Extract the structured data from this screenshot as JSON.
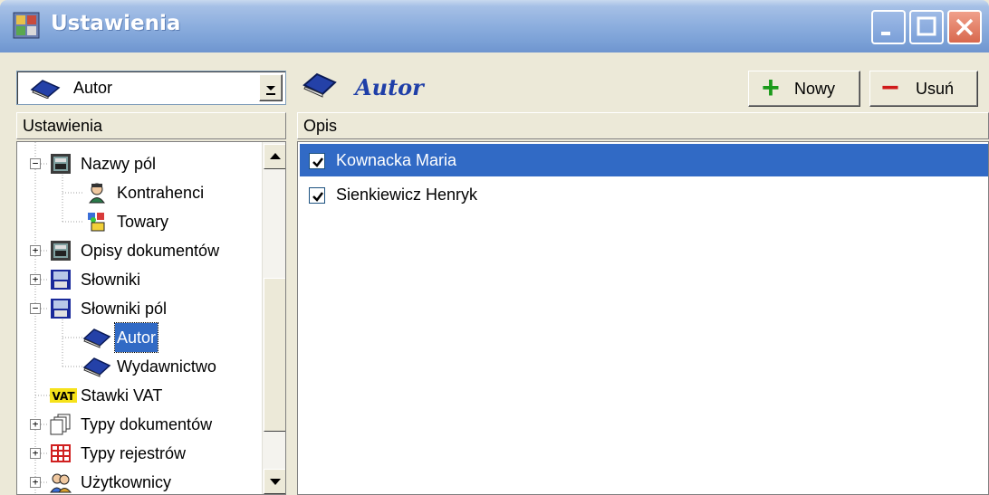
{
  "window": {
    "title": "Ustawienia",
    "accent_color": "#316ac5"
  },
  "left": {
    "combo_value": "Autor",
    "header": "Ustawienia",
    "tree": [
      {
        "label": "Nazwy pól",
        "icon": "form-icon",
        "expander": "−"
      },
      {
        "label": "Kontrahenci",
        "icon": "person-icon"
      },
      {
        "label": "Towary",
        "icon": "goods-icon"
      },
      {
        "label": "Opisy dokumentów",
        "icon": "form-icon",
        "expander": "+"
      },
      {
        "label": "Słowniki",
        "icon": "dictionary-icon",
        "expander": "+"
      },
      {
        "label": "Słowniki pól",
        "icon": "dictionary-icon",
        "expander": "−"
      },
      {
        "label": "Autor",
        "icon": "book-icon",
        "selected": true
      },
      {
        "label": "Wydawnictwo",
        "icon": "book-icon"
      },
      {
        "label": "Stawki VAT",
        "icon": "vat-icon"
      },
      {
        "label": "Typy dokumentów",
        "icon": "documents-icon",
        "expander": "+"
      },
      {
        "label": "Typy rejestrów",
        "icon": "register-grid-icon",
        "expander": "+"
      },
      {
        "label": "Użytkownicy",
        "icon": "users-icon",
        "expander": "+"
      }
    ]
  },
  "right": {
    "title": "Autor",
    "new_button": "Nowy",
    "delete_button": "Usuń",
    "column_header": "Opis",
    "items": [
      {
        "text": "Kownacka Maria",
        "checked": true,
        "selected": true
      },
      {
        "text": "Sienkiewicz Henryk",
        "checked": true,
        "selected": false
      }
    ]
  }
}
